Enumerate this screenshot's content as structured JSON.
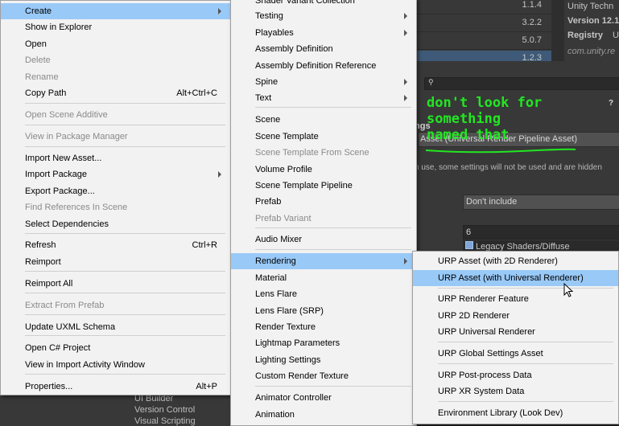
{
  "background": {
    "packages": {
      "rows": [
        {
          "version": "1.1.4"
        },
        {
          "version": "3.2.2"
        },
        {
          "version": "5.0.7"
        },
        {
          "version": "1.2.3"
        }
      ],
      "publisher": "Unity Techn",
      "version_label": "Version 12.1",
      "registry_label": "Registry",
      "registry_value": "U",
      "package_id": "com.unity.re"
    },
    "inspector": {
      "search_glyph": "🔍",
      "help_glyph": "?",
      "heading_fragment": "ngs",
      "asset_field": "Asset (Universal Render Pipeline Asset)",
      "note": "n use, some settings will not be used and are hidden",
      "dropdown_value": "Don't include",
      "number_value": "6",
      "shader_value": "Legacy Shaders/Diffuse"
    },
    "annotation": [
      "don't look for something",
      "named that"
    ],
    "bottom_list": [
      "UI Builder",
      "Version Control",
      "Visual Scripting"
    ]
  },
  "context_menu": {
    "items": [
      {
        "label": "Create",
        "submenu": true,
        "highlighted": true
      },
      {
        "label": "Show in Explorer"
      },
      {
        "label": "Open"
      },
      {
        "label": "Delete",
        "disabled": true
      },
      {
        "label": "Rename",
        "disabled": true
      },
      {
        "label": "Copy Path",
        "shortcut": "Alt+Ctrl+C"
      },
      {
        "label": "Open Scene Additive",
        "disabled": true
      },
      {
        "label": "View in Package Manager",
        "disabled": true
      },
      {
        "label": "Import New Asset..."
      },
      {
        "label": "Import Package",
        "submenu": true
      },
      {
        "label": "Export Package..."
      },
      {
        "label": "Find References In Scene",
        "disabled": true
      },
      {
        "label": "Select Dependencies"
      },
      {
        "label": "Refresh",
        "shortcut": "Ctrl+R"
      },
      {
        "label": "Reimport"
      },
      {
        "label": "Reimport All"
      },
      {
        "label": "Extract From Prefab",
        "disabled": true
      },
      {
        "label": "Update UXML Schema"
      },
      {
        "label": "Open C# Project"
      },
      {
        "label": "View in Import Activity Window"
      },
      {
        "label": "Properties...",
        "shortcut": "Alt+P"
      }
    ]
  },
  "create_menu": {
    "items": [
      {
        "label": "Shader Variant Collection"
      },
      {
        "label": "Testing",
        "submenu": true
      },
      {
        "label": "Playables",
        "submenu": true
      },
      {
        "label": "Assembly Definition"
      },
      {
        "label": "Assembly Definition Reference"
      },
      {
        "label": "Spine",
        "submenu": true
      },
      {
        "label": "Text",
        "submenu": true
      },
      {
        "label": "Scene"
      },
      {
        "label": "Scene Template"
      },
      {
        "label": "Scene Template From Scene",
        "disabled": true
      },
      {
        "label": "Volume Profile"
      },
      {
        "label": "Scene Template Pipeline"
      },
      {
        "label": "Prefab"
      },
      {
        "label": "Prefab Variant",
        "disabled": true
      },
      {
        "label": "Audio Mixer"
      },
      {
        "label": "Rendering",
        "submenu": true,
        "highlighted": true
      },
      {
        "label": "Material"
      },
      {
        "label": "Lens Flare"
      },
      {
        "label": "Lens Flare (SRP)"
      },
      {
        "label": "Render Texture"
      },
      {
        "label": "Lightmap Parameters"
      },
      {
        "label": "Lighting Settings"
      },
      {
        "label": "Custom Render Texture"
      },
      {
        "label": "Animator Controller"
      },
      {
        "label": "Animation"
      }
    ]
  },
  "rendering_menu": {
    "items": [
      {
        "label": "URP Asset (with 2D Renderer)"
      },
      {
        "label": "URP Asset (with Universal Renderer)",
        "highlighted": true
      },
      {
        "label": "URP Renderer Feature"
      },
      {
        "label": "URP 2D Renderer"
      },
      {
        "label": "URP Universal Renderer"
      },
      {
        "label": "URP Global Settings Asset"
      },
      {
        "label": "URP Post-process Data"
      },
      {
        "label": "URP XR System Data"
      },
      {
        "label": "Environment Library (Look Dev)"
      }
    ]
  },
  "colors": {
    "menu_bg": "#f2f2f2",
    "highlight": "#99c9f7",
    "annotation_green": "#22e622",
    "editor_dark": "#383838"
  }
}
